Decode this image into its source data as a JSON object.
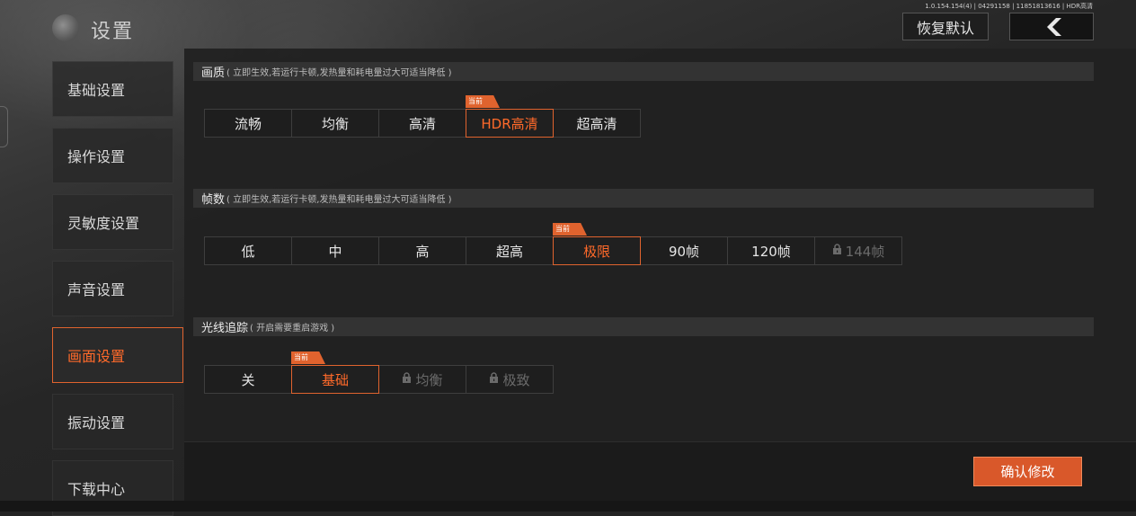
{
  "header": {
    "title": "设置",
    "version_info": "1.0.154.154(4) | 04291158 | 11851813616 | HDR高清",
    "reset_label": "恢复默认"
  },
  "sidebar": {
    "items": [
      {
        "label": "基础设置",
        "active": false
      },
      {
        "label": "操作设置",
        "active": false
      },
      {
        "label": "灵敏度设置",
        "active": false
      },
      {
        "label": "声音设置",
        "active": false
      },
      {
        "label": "画面设置",
        "active": true
      },
      {
        "label": "振动设置",
        "active": false
      },
      {
        "label": "下载中心",
        "active": false
      }
    ]
  },
  "sections": [
    {
      "title": "画质",
      "note": "( 立即生效,若运行卡顿,发热量和耗电量过大可适当降低 )",
      "current_tag": "当前",
      "options": [
        {
          "label": "流畅",
          "selected": false,
          "locked": false
        },
        {
          "label": "均衡",
          "selected": false,
          "locked": false
        },
        {
          "label": "高清",
          "selected": false,
          "locked": false
        },
        {
          "label": "HDR高清",
          "selected": true,
          "locked": false
        },
        {
          "label": "超高清",
          "selected": false,
          "locked": false
        }
      ]
    },
    {
      "title": "帧数",
      "note": "( 立即生效,若运行卡顿,发热量和耗电量过大可适当降低 )",
      "current_tag": "当前",
      "options": [
        {
          "label": "低",
          "selected": false,
          "locked": false
        },
        {
          "label": "中",
          "selected": false,
          "locked": false
        },
        {
          "label": "高",
          "selected": false,
          "locked": false
        },
        {
          "label": "超高",
          "selected": false,
          "locked": false
        },
        {
          "label": "极限",
          "selected": true,
          "locked": false
        },
        {
          "label": "90帧",
          "selected": false,
          "locked": false
        },
        {
          "label": "120帧",
          "selected": false,
          "locked": false
        },
        {
          "label": "144帧",
          "selected": false,
          "locked": true
        }
      ]
    },
    {
      "title": "光线追踪",
      "note": "( 开启需要重启游戏 )",
      "current_tag": "当前",
      "options": [
        {
          "label": "关",
          "selected": false,
          "locked": false
        },
        {
          "label": "基础",
          "selected": true,
          "locked": false
        },
        {
          "label": "均衡",
          "selected": false,
          "locked": true
        },
        {
          "label": "极致",
          "selected": false,
          "locked": true
        }
      ]
    }
  ],
  "footer": {
    "confirm_label": "确认修改"
  },
  "colors": {
    "accent": "#e0632e",
    "accent_text": "#ff6a2a",
    "panel": "#212121",
    "header_bar": "#333333"
  },
  "icons": {
    "back": "chevron-left-icon",
    "lock": "lock-icon",
    "logo": "globe-logo-icon"
  }
}
